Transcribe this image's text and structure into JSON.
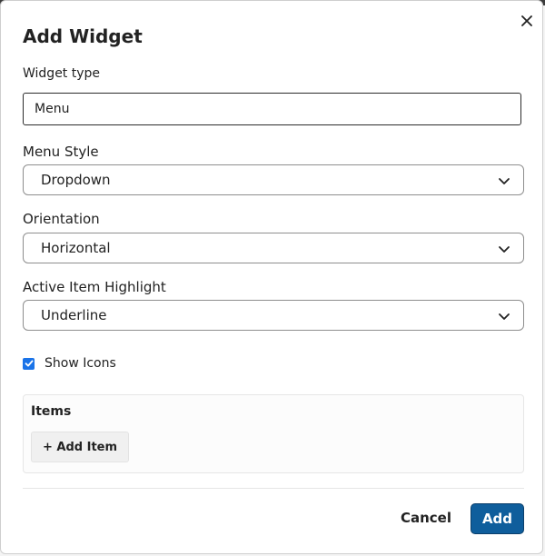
{
  "dialog": {
    "title": "Add Widget",
    "close_icon": "close-icon"
  },
  "widget_type": {
    "label": "Widget type",
    "value": "Menu"
  },
  "menu_style": {
    "label": "Menu Style",
    "value": "Dropdown"
  },
  "orientation": {
    "label": "Orientation",
    "value": "Horizontal"
  },
  "active_item_highlight": {
    "label": "Active Item Highlight",
    "value": "Underline"
  },
  "show_icons": {
    "label": "Show Icons",
    "checked": true
  },
  "items": {
    "title": "Items",
    "add_button_label": "+ Add Item"
  },
  "footer": {
    "cancel_label": "Cancel",
    "add_label": "Add"
  },
  "colors": {
    "primary_button": "#0f5e9c",
    "checkbox_accent": "#1a73e8"
  }
}
